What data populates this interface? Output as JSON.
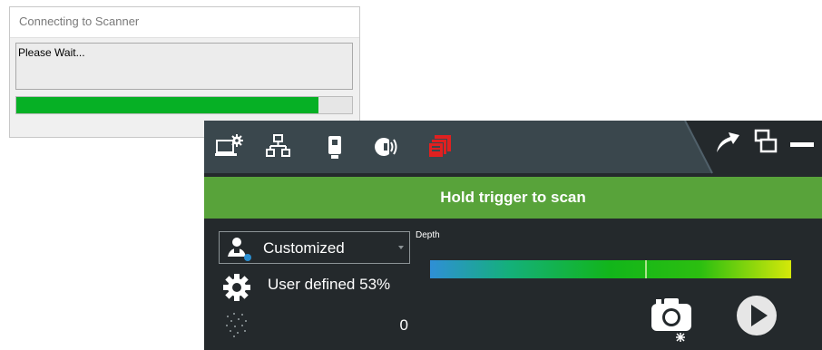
{
  "dialog": {
    "title": "Connecting to Scanner",
    "message": "Please Wait...",
    "progress": 0.9
  },
  "scanner": {
    "toolbar_icons": [
      "laptop-settings-icon",
      "network-icon",
      "scanner-device-icon",
      "wireless-signal-icon",
      "stacked-documents-icon"
    ],
    "window_icons": [
      "share-arrow-icon",
      "restore-windows-icon",
      "minimize-icon"
    ],
    "banner": "Hold trigger to scan",
    "profile": {
      "selected": "Customized",
      "icon": "user-profile-icon"
    },
    "resolution": {
      "label": "User defined 53%",
      "icon": "gear-icon"
    },
    "point_count": {
      "icon": "point-cloud-icon",
      "value": "0"
    },
    "depth_label": "Depth",
    "buttons": {
      "camera": "camera-icon",
      "play": "play-icon"
    },
    "colors": {
      "panel_bg": "#24292c",
      "toolbar_bg": "#3a474d",
      "banner_bg": "#58a33a",
      "alert_red": "#e02020",
      "progress_green": "#06b025"
    }
  }
}
